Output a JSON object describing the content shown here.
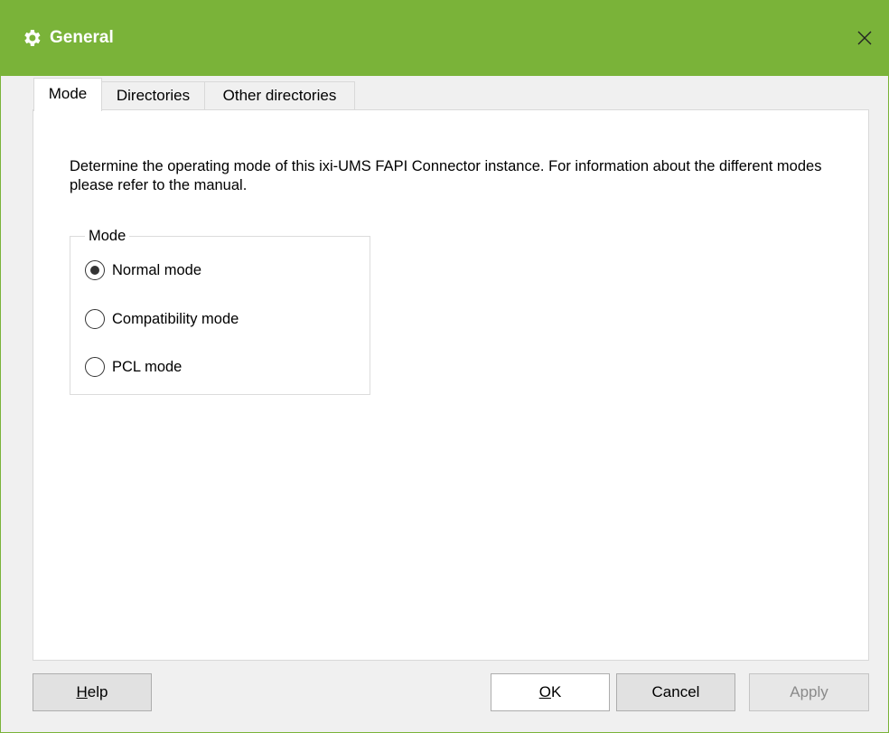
{
  "window": {
    "title": "General",
    "icon": "gear-icon",
    "close_glyph": "×",
    "accent_color": "#7ab339"
  },
  "tabs": [
    {
      "label": "Mode",
      "active": true
    },
    {
      "label": "Directories",
      "active": false
    },
    {
      "label": "Other directories",
      "active": false
    }
  ],
  "mode_tab": {
    "description": "Determine the operating mode of this ixi-UMS FAPI Connector instance. For information about the different modes please refer to the manual.",
    "group_label": "Mode",
    "options": [
      {
        "label": "Normal mode",
        "selected": true
      },
      {
        "label": "Compatibility mode",
        "selected": false
      },
      {
        "label": "PCL mode",
        "selected": false
      }
    ]
  },
  "buttons": {
    "help": {
      "mnemonic": "H",
      "rest": "elp"
    },
    "ok": {
      "mnemonic": "O",
      "rest": "K"
    },
    "cancel": "Cancel",
    "apply": "Apply"
  }
}
